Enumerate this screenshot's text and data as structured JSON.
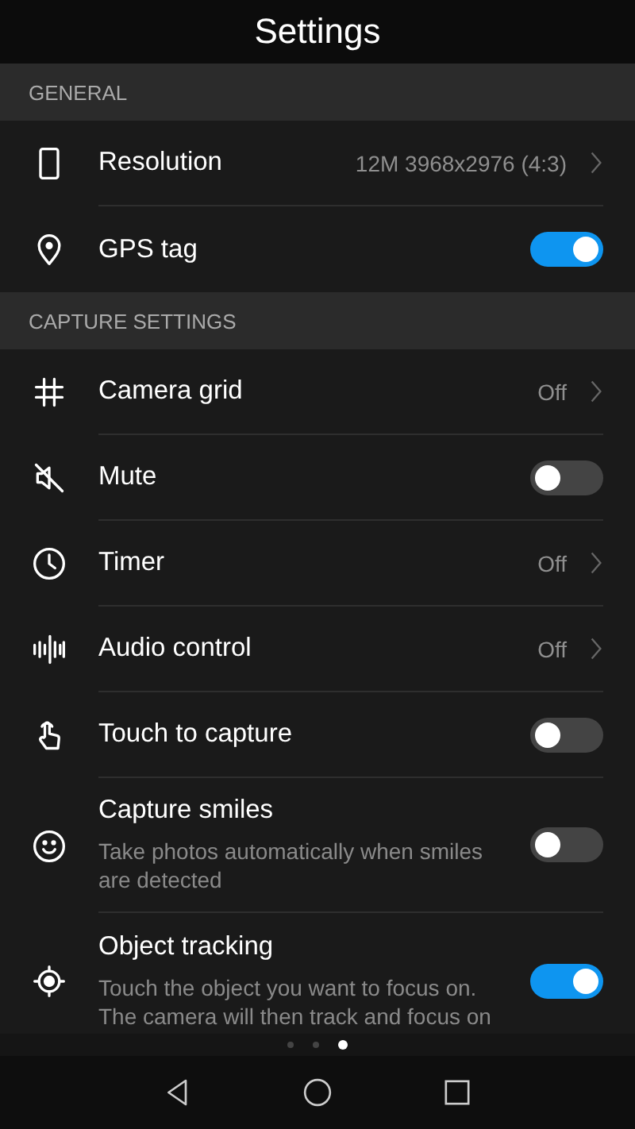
{
  "title": "Settings",
  "sections": [
    {
      "heading": "GENERAL",
      "rows": [
        {
          "label": "Resolution",
          "kind": "link",
          "value": "12M 3968x2976 (4:3)"
        },
        {
          "label": "GPS tag",
          "kind": "switch",
          "on": true
        }
      ]
    },
    {
      "heading": "CAPTURE SETTINGS",
      "rows": [
        {
          "label": "Camera grid",
          "kind": "link",
          "value": "Off"
        },
        {
          "label": "Mute",
          "kind": "switch",
          "on": false
        },
        {
          "label": "Timer",
          "kind": "link",
          "value": "Off"
        },
        {
          "label": "Audio control",
          "kind": "link",
          "value": "Off"
        },
        {
          "label": "Touch to capture",
          "kind": "switch",
          "on": false
        },
        {
          "label": "Capture smiles",
          "kind": "switch",
          "on": false,
          "description": "Take photos automatically when smiles are detected"
        },
        {
          "label": "Object tracking",
          "kind": "switch",
          "on": true,
          "description": "Touch the object you want to focus on. The camera will then track and focus on"
        }
      ]
    }
  ],
  "pager": [
    {
      "selected": false
    },
    {
      "selected": false
    },
    {
      "selected": true
    }
  ]
}
